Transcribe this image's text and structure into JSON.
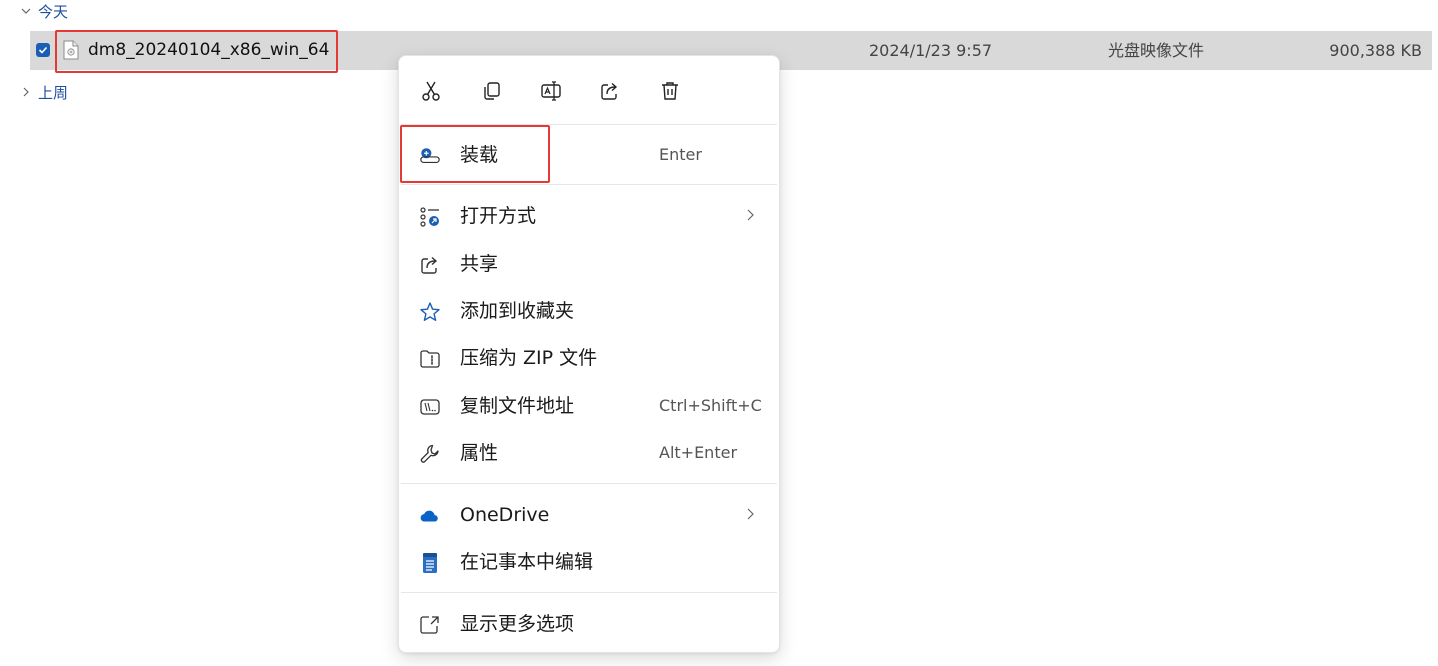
{
  "groups": {
    "today": "今天",
    "last_week": "上周"
  },
  "file": {
    "name": "dm8_20240104_x86_win_64",
    "date": "2024/1/23 9:57",
    "type": "光盘映像文件",
    "size": "900,388 KB",
    "checked": true
  },
  "context_menu": {
    "quick_actions": [
      "cut-icon",
      "copy-icon",
      "rename-icon",
      "share-icon",
      "delete-icon"
    ],
    "items": [
      {
        "label": "装载",
        "shortcut": "Enter",
        "icon": "mount-icon"
      },
      {
        "label": "打开方式",
        "shortcut": "",
        "icon": "open-with-icon",
        "submenu": true
      },
      {
        "label": "共享",
        "shortcut": "",
        "icon": "share-icon"
      },
      {
        "label": "添加到收藏夹",
        "shortcut": "",
        "icon": "star-icon"
      },
      {
        "label": "压缩为 ZIP 文件",
        "shortcut": "",
        "icon": "zip-icon"
      },
      {
        "label": "复制文件地址",
        "shortcut": "Ctrl+Shift+C",
        "icon": "copy-path-icon"
      },
      {
        "label": "属性",
        "shortcut": "Alt+Enter",
        "icon": "wrench-icon"
      },
      {
        "label": "OneDrive",
        "shortcut": "",
        "icon": "onedrive-icon",
        "submenu": true
      },
      {
        "label": "在记事本中编辑",
        "shortcut": "",
        "icon": "notepad-icon"
      },
      {
        "label": "显示更多选项",
        "shortcut": "",
        "icon": "more-options-icon"
      }
    ]
  },
  "colors": {
    "accent": "#1a5fb4",
    "highlight_box": "#e53935",
    "selected_row": "#d9d9d9"
  }
}
